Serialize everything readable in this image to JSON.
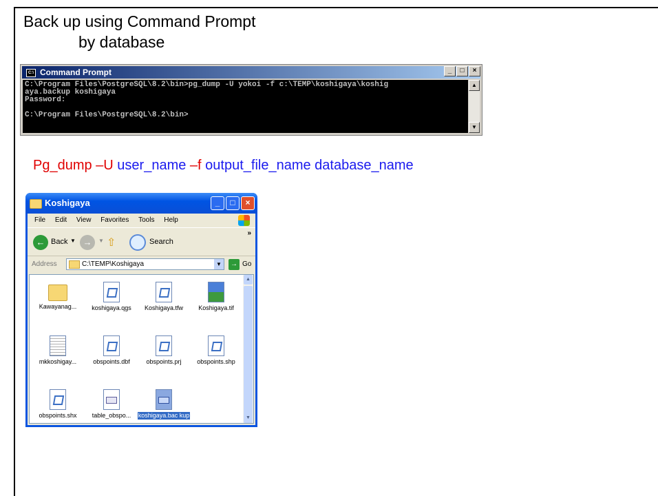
{
  "slide": {
    "title_line1": "Back up using Command Prompt",
    "title_line2": "by database"
  },
  "cmd": {
    "window_title": "Command Prompt",
    "lines": [
      "C:\\Program Files\\PostgreSQL\\8.2\\bin>pg_dump -U yokoi -f c:\\TEMP\\koshigaya\\koshig",
      "aya.backup koshigaya",
      "Password:",
      "",
      "C:\\Program Files\\PostgreSQL\\8.2\\bin>"
    ]
  },
  "syntax": {
    "part1": "Pg_dump –U ",
    "part2": "user_name",
    "part3": " –f ",
    "part4": "output_file_name database_name"
  },
  "explorer": {
    "window_title": "Koshigaya",
    "menu": [
      "File",
      "Edit",
      "View",
      "Favorites",
      "Tools",
      "Help"
    ],
    "toolbar": {
      "back_label": "Back",
      "search_label": "Search"
    },
    "address": {
      "label": "Address",
      "value": "C:\\TEMP\\Koshigaya",
      "go_label": "Go"
    },
    "files": [
      {
        "name": "Kawayanag...",
        "icon": "folder-icon"
      },
      {
        "name": "koshigaya.qgs",
        "icon": "document-icon"
      },
      {
        "name": "Koshigaya.tfw",
        "icon": "document-icon"
      },
      {
        "name": "Koshigaya.tif",
        "icon": "image-file-icon"
      },
      {
        "name": "mkkoshigay...",
        "icon": "text-file-icon"
      },
      {
        "name": "obspoints.dbf",
        "icon": "document-icon"
      },
      {
        "name": "obspoints.prj",
        "icon": "document-icon"
      },
      {
        "name": "obspoints.shp",
        "icon": "document-icon"
      },
      {
        "name": "obspoints.shx",
        "icon": "document-icon"
      },
      {
        "name": "table_obspo...",
        "icon": "database-file-icon"
      },
      {
        "name": "koshigaya.bac kup",
        "icon": "backup-file-icon",
        "selected": true
      }
    ]
  }
}
